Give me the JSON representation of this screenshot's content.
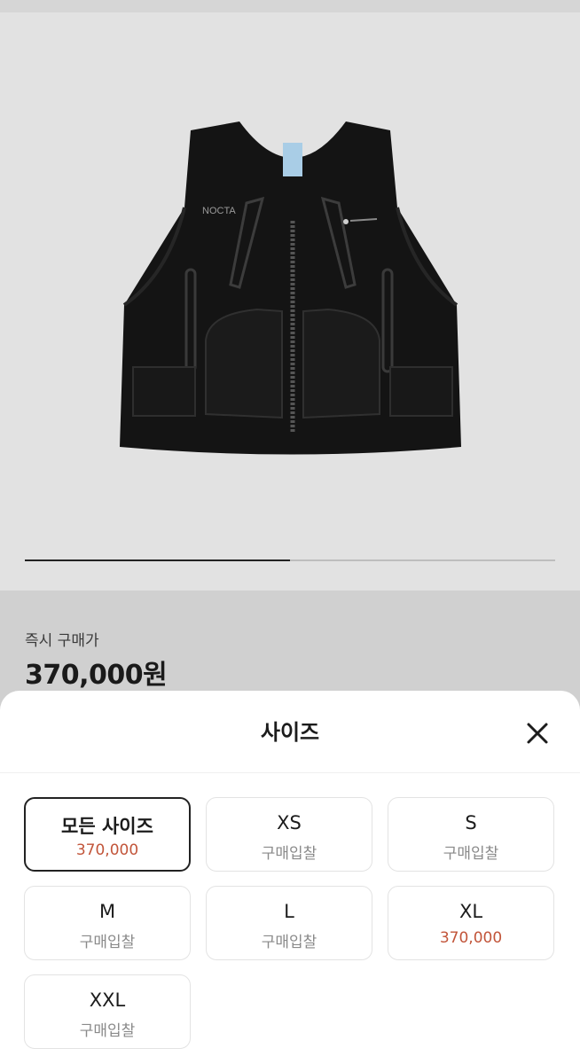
{
  "product": {
    "brand_mark": "NOCTA",
    "image_progress": 0.5
  },
  "price": {
    "label": "즉시 구매가",
    "value": "370,000원"
  },
  "sheet": {
    "title": "사이즈",
    "options": [
      {
        "name": "모든 사이즈",
        "sub": "370,000",
        "kind": "price",
        "selected": true
      },
      {
        "name": "XS",
        "sub": "구매입찰",
        "kind": "bid",
        "selected": false
      },
      {
        "name": "S",
        "sub": "구매입찰",
        "kind": "bid",
        "selected": false
      },
      {
        "name": "M",
        "sub": "구매입찰",
        "kind": "bid",
        "selected": false
      },
      {
        "name": "L",
        "sub": "구매입찰",
        "kind": "bid",
        "selected": false
      },
      {
        "name": "XL",
        "sub": "370,000",
        "kind": "price",
        "selected": false
      },
      {
        "name": "XXL",
        "sub": "구매입찰",
        "kind": "bid",
        "selected": false
      }
    ]
  },
  "colors": {
    "accent_price": "#c2553a",
    "selected_border": "#222222"
  },
  "icons": {
    "close": "close-icon"
  }
}
